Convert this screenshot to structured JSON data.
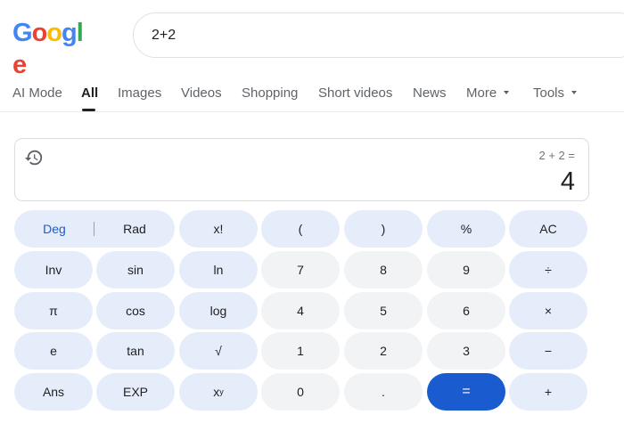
{
  "logo": {
    "text": "Google"
  },
  "search": {
    "query": "2+2"
  },
  "tabs": [
    {
      "label": "AI Mode"
    },
    {
      "label": "All"
    },
    {
      "label": "Images"
    },
    {
      "label": "Videos"
    },
    {
      "label": "Shopping"
    },
    {
      "label": "Short videos"
    },
    {
      "label": "News"
    },
    {
      "label": "More"
    },
    {
      "label": "Tools"
    }
  ],
  "calculator": {
    "expression": "2 + 2 =",
    "result": "4",
    "deg_label": "Deg",
    "rad_label": "Rad",
    "keys": {
      "factorial": "x!",
      "open_paren": "(",
      "close_paren": ")",
      "percent": "%",
      "clear": "AC",
      "inv": "Inv",
      "sin": "sin",
      "ln": "ln",
      "seven": "7",
      "eight": "8",
      "nine": "9",
      "divide": "÷",
      "pi": "π",
      "cos": "cos",
      "log": "log",
      "four": "4",
      "five": "5",
      "six": "6",
      "multiply": "×",
      "e": "e",
      "tan": "tan",
      "sqrt": "√",
      "one": "1",
      "two": "2",
      "three": "3",
      "minus": "−",
      "ans": "Ans",
      "exp": "EXP",
      "power_base": "x",
      "power_exp": "y",
      "zero": "0",
      "decimal": ".",
      "equals": "=",
      "plus": "+"
    }
  },
  "colors": {
    "accent": "#1a5ccf",
    "op_key_bg": "#e6edfa",
    "num_key_bg": "#f1f3f4"
  }
}
